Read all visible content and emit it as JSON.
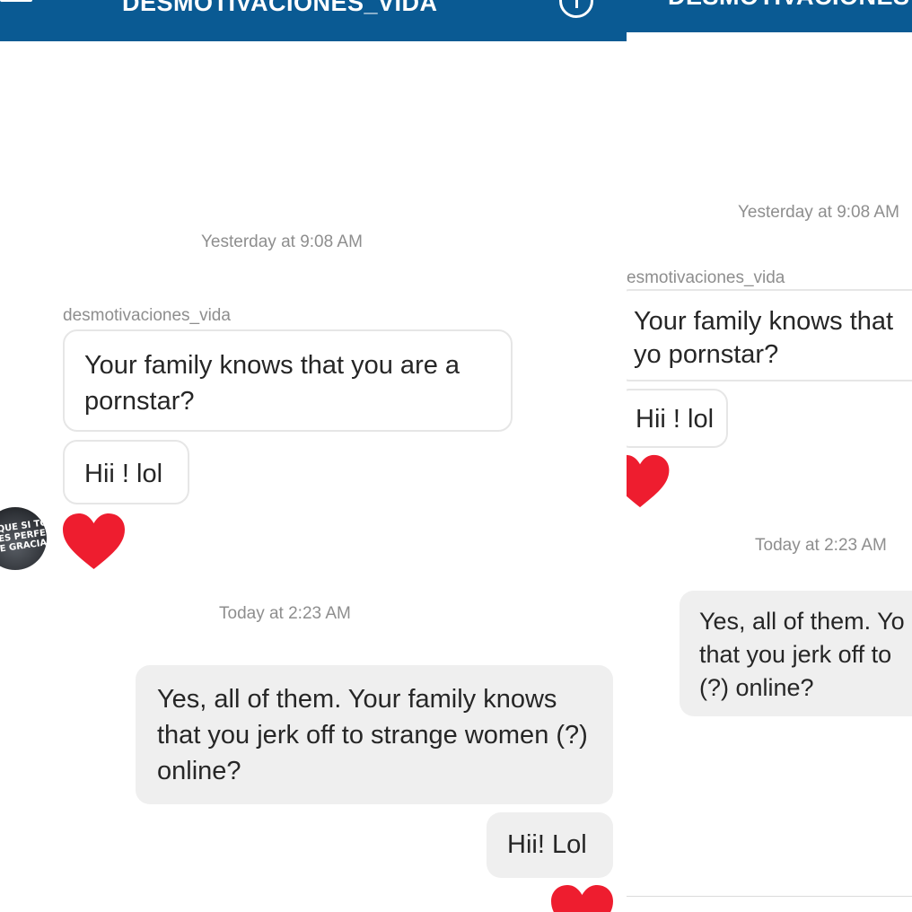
{
  "left": {
    "header": {
      "title": "DESMOTIVACIONES_VIDA"
    },
    "messages": {
      "timestamp_1": "Yesterday at 9:08 AM",
      "sender": "desmotivaciones_vida",
      "incoming_1": "Your family knows that you are a pornstar?",
      "incoming_2": "Hii ! lol",
      "timestamp_2": "Today at 2:23 AM",
      "outgoing_1": "Yes, all of them. Your family knows that you jerk off to strange women (?) online?",
      "outgoing_2": "Hii! Lol"
    },
    "avatar_text": "QUE SI TO\nES PERFECTO\nE GRACIA TIEN"
  },
  "right": {
    "header": {
      "title": "DESMOTIVACIONES"
    },
    "messages": {
      "timestamp_1": "Yesterday at 9:08 AM",
      "sender": "esmotivaciones_vida",
      "incoming_1": "Your family knows that yo pornstar?",
      "incoming_2": "Hii ! lol",
      "timestamp_2": "Today at 2:23 AM",
      "outgoing_1": "Yes, all of them. Yo that you jerk off to (?) online?"
    }
  },
  "colors": {
    "navbar": "#0a5a93",
    "heart": "#ee1d2f",
    "incoming_border": "#e6e6e6",
    "outgoing_bg": "#efefef",
    "meta_text": "#8e8e8e"
  },
  "icons": [
    "back-arrow-icon",
    "info-icon",
    "heart-icon"
  ]
}
